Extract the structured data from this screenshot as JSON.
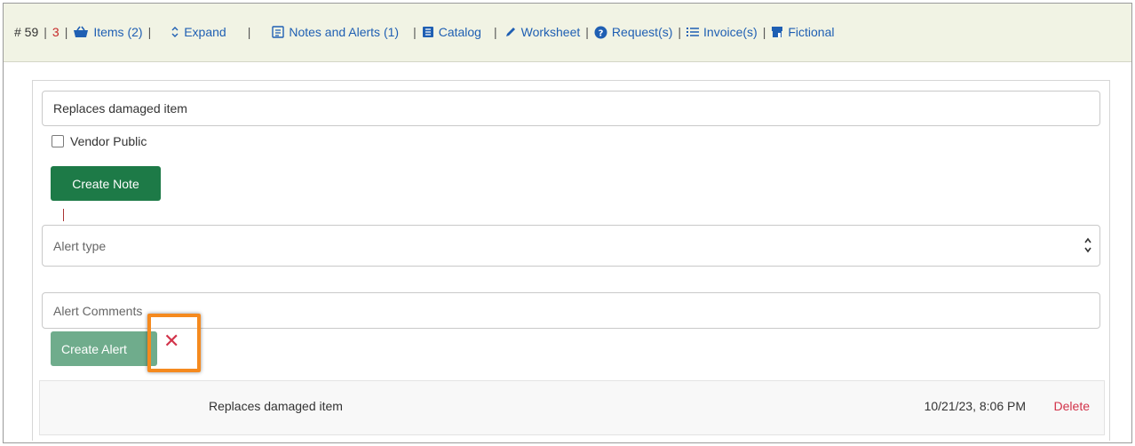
{
  "toolbar": {
    "order_number": "# 59",
    "count": "3",
    "separator": "|",
    "items_label": "Items (2)",
    "expand_label": "Expand",
    "notes_label": "Notes and Alerts (1)",
    "catalog_label": "Catalog",
    "worksheet_label": "Worksheet",
    "requests_label": "Request(s)",
    "invoices_label": "Invoice(s)",
    "fictional_label": "Fictional"
  },
  "note_form": {
    "note_value": "Replaces damaged item",
    "vendor_public_label": "Vendor Public",
    "vendor_public_checked": false,
    "create_note_label": "Create Note"
  },
  "alert_form": {
    "alert_type_placeholder": "Alert type",
    "alert_comments_placeholder": "Alert Comments",
    "create_alert_label": "Create Alert",
    "close_symbol": "✕"
  },
  "notes_list": [
    {
      "text": "Replaces damaged item",
      "timestamp": "10/21/23, 8:06 PM",
      "delete_label": "Delete"
    }
  ],
  "colors": {
    "topbar_bg": "#f1f3e4",
    "link": "#1f5fb3",
    "button_green": "#1d7a47",
    "danger": "#d2334a",
    "highlight": "#f58a1f"
  },
  "icons": {
    "items": "basket-icon",
    "expand": "chevron-up-down-icon",
    "notes": "note-icon",
    "catalog": "book-icon",
    "worksheet": "pencil-icon",
    "requests": "question-circle-icon",
    "invoices": "list-icon",
    "fictional": "store-icon"
  }
}
